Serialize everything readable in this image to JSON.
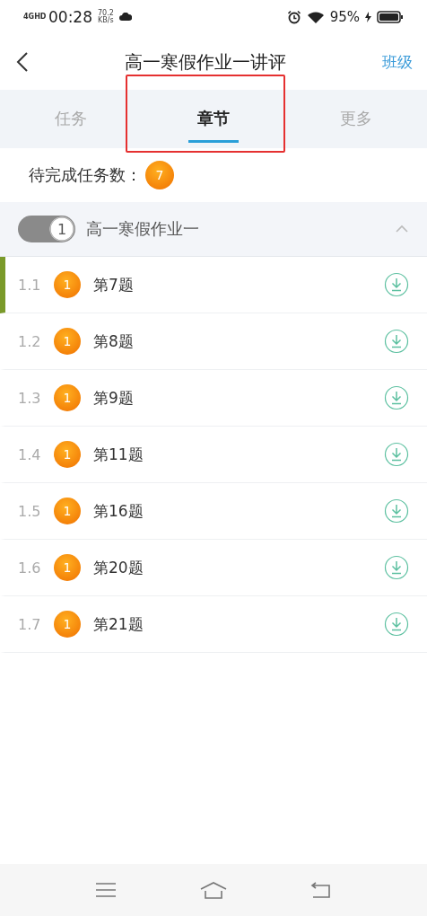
{
  "status_bar": {
    "network": "4GHD",
    "time": "00:28",
    "speed": "70.2",
    "speed_unit": "KB/s",
    "battery": "95%"
  },
  "header": {
    "title": "高一寒假作业一讲评",
    "action": "班级"
  },
  "tabs": [
    {
      "label": "任务",
      "selected": false,
      "highlighted": false
    },
    {
      "label": "章节",
      "selected": true,
      "highlighted": true
    },
    {
      "label": "更多",
      "selected": false,
      "highlighted": false
    }
  ],
  "pending": {
    "label": "待完成任务数：",
    "count": "7"
  },
  "chapter": {
    "number": "1",
    "title": "高一寒假作业一",
    "expanded": true,
    "items": [
      {
        "index": "1.1",
        "count": "1",
        "title": "第7题",
        "selected": true
      },
      {
        "index": "1.2",
        "count": "1",
        "title": "第8题",
        "selected": false
      },
      {
        "index": "1.3",
        "count": "1",
        "title": "第9题",
        "selected": false
      },
      {
        "index": "1.4",
        "count": "1",
        "title": "第11题",
        "selected": false
      },
      {
        "index": "1.5",
        "count": "1",
        "title": "第16题",
        "selected": false
      },
      {
        "index": "1.6",
        "count": "1",
        "title": "第20题",
        "selected": false
      },
      {
        "index": "1.7",
        "count": "1",
        "title": "第21题",
        "selected": false
      }
    ]
  }
}
